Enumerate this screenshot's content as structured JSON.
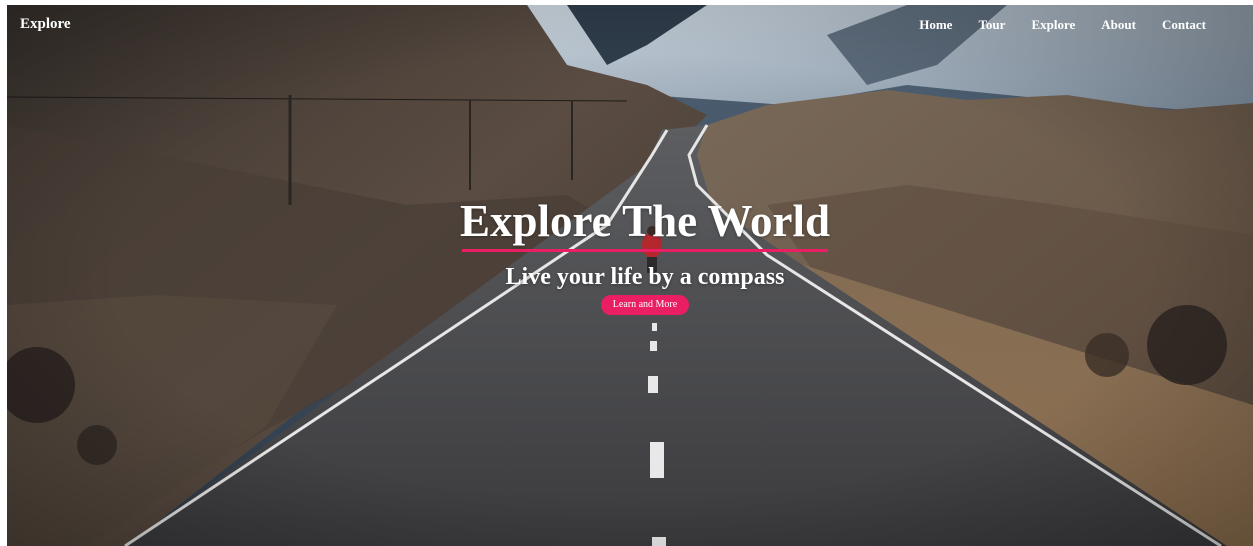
{
  "navbar": {
    "brand": "Explore",
    "links": [
      "Home",
      "Tour",
      "Explore",
      "About",
      "Contact"
    ]
  },
  "hero": {
    "title": "Explore The World",
    "subtitle": "Live your life by a compass",
    "cta_label": "Learn and More"
  },
  "colors": {
    "accent": "#e91e63",
    "text": "#ffffff"
  }
}
